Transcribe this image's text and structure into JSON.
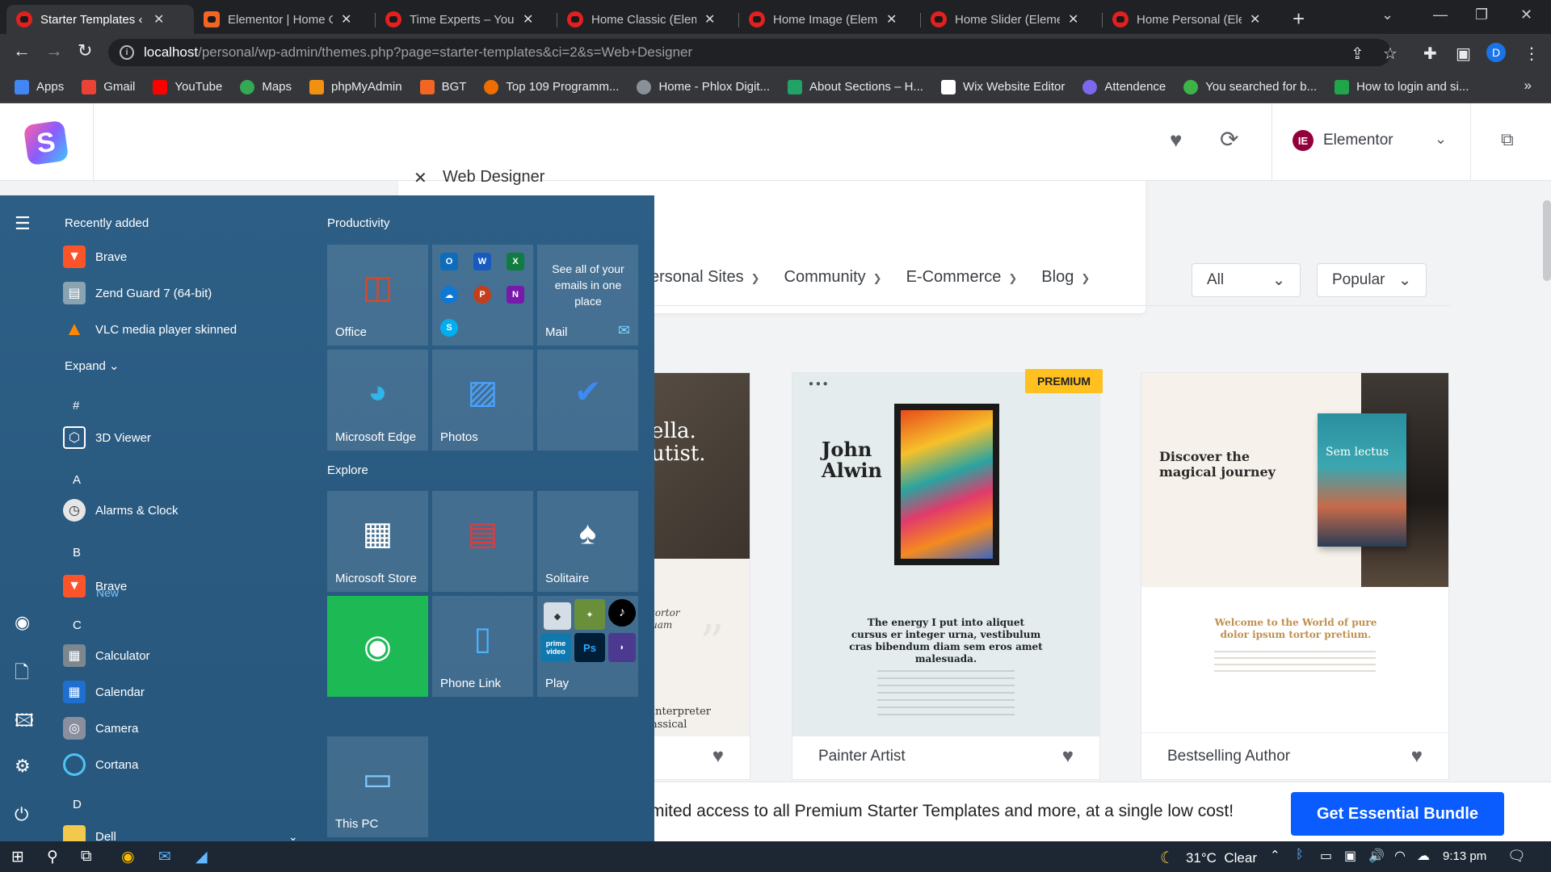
{
  "browser": {
    "tabs": [
      {
        "title": "Starter Templates ‹ Ti",
        "favicon": "youtube-red-icon",
        "active": true
      },
      {
        "title": "Elementor | Home On",
        "favicon": "app-orange-icon",
        "active": false
      },
      {
        "title": "Time Experts – Your V",
        "favicon": "youtube-red-icon",
        "active": false
      },
      {
        "title": "Home Classic (Elemen",
        "favicon": "youtube-red-icon",
        "active": false
      },
      {
        "title": "Home Image (Elemen",
        "favicon": "youtube-red-icon",
        "active": false
      },
      {
        "title": "Home Slider (Element",
        "favicon": "youtube-red-icon",
        "active": false
      },
      {
        "title": "Home Personal (Elem",
        "favicon": "youtube-red-icon",
        "active": false
      }
    ],
    "url": {
      "host": "localhost",
      "path": "/personal/wp-admin/themes.php?page=starter-templates&ci=2&s=Web+Designer"
    },
    "profile_initial": "D",
    "bookmarks": [
      {
        "label": "Apps",
        "color": "#4285f4"
      },
      {
        "label": "Gmail",
        "color": "#ea4335"
      },
      {
        "label": "YouTube",
        "color": "#ff0000"
      },
      {
        "label": "Maps",
        "color": "#34a853"
      },
      {
        "label": "phpMyAdmin",
        "color": "#f29111"
      },
      {
        "label": "BGT",
        "color": "#f26522"
      },
      {
        "label": "Top 109 Programm...",
        "color": "#ef6c00"
      },
      {
        "label": "Home - Phlox Digit...",
        "color": "#8a9099"
      },
      {
        "label": "About Sections – H...",
        "color": "#21a366"
      },
      {
        "label": "Wix Website Editor",
        "color": "#ffffff"
      },
      {
        "label": "Attendence",
        "color": "#7b68ee"
      },
      {
        "label": "You searched for b...",
        "color": "#3db34a"
      },
      {
        "label": "How to login and si...",
        "color": "#1fa54a"
      }
    ]
  },
  "starter_templates": {
    "builder": "Elementor",
    "search_query": "Web Designer",
    "categories": [
      "ersonal Sites",
      "Community",
      "E-Commerce",
      "Blog"
    ],
    "filter_type": "All",
    "filter_sort": "Popular",
    "cards": [
      {
        "name": "",
        "thumb_text_1": "ella.",
        "thumb_text_2": "utist.",
        "thumb_text_3": "tortor",
        "thumb_text_4": "uam",
        "thumb_text_5": "Interpreter",
        "thumb_text_6": "assical"
      },
      {
        "name": "Painter Artist",
        "premium": "PREMIUM",
        "thumb_title": "John Alwin",
        "thumb_quote": "The energy I put into aliquet cursus er integer urna, vestibulum cras bibendum diam sem eros amet malesuada."
      },
      {
        "name": "Bestselling Author",
        "thumb_title": "Discover the magical journey",
        "thumb_book": "Sem lectus",
        "thumb_welcome": "Welcome to the World of pure dolor ipsum tortor pretium."
      }
    ],
    "bundle_text": "mited access to all Premium Starter Templates and more, at a single low cost!",
    "bundle_button": "Get Essential Bundle"
  },
  "start_menu": {
    "recently_added_title": "Recently added",
    "recent": [
      "Brave",
      "Zend Guard 7 (64-bit)",
      "VLC media player skinned"
    ],
    "expand_label": "Expand",
    "letters": [
      "#",
      "A",
      "B",
      "C",
      "D"
    ],
    "apps": {
      "viewer": "3D Viewer",
      "alarms": "Alarms & Clock",
      "brave": "Brave",
      "brave_badge": "New",
      "calculator": "Calculator",
      "calendar": "Calendar",
      "camera": "Camera",
      "cortana": "Cortana",
      "dell": "Dell"
    },
    "productivity_title": "Productivity",
    "explore_title": "Explore",
    "tiles": {
      "office": "Office",
      "mail": "Mail",
      "mail_text": "See all of your emails in one place",
      "edge": "Microsoft Edge",
      "photos": "Photos",
      "store": "Microsoft Store",
      "solitaire": "Solitaire",
      "phone_link": "Phone Link",
      "play": "Play",
      "this_pc": "This PC",
      "play_mini_prime": "prime video",
      "play_mini_ps": "Ps"
    }
  },
  "taskbar": {
    "temperature": "31°C",
    "weather": "Clear",
    "time": "9:13 pm"
  }
}
